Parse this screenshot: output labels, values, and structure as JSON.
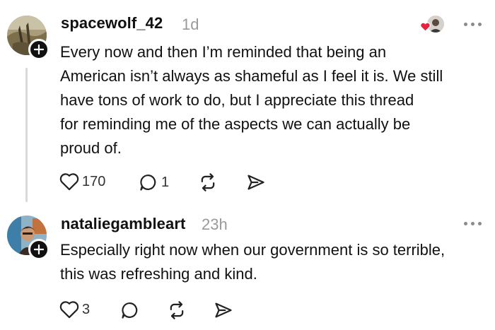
{
  "posts": [
    {
      "username": "spacewolf_42",
      "timestamp": "1d",
      "text_lines": [
        "Every now and then I’m reminded that being an",
        "American isn’t always as shameful as I feel it is. We still",
        "have tons of work to do, but I appreciate this thread",
        "for reminding me of the aspects we can actually be",
        "proud of."
      ],
      "like_count": "170",
      "reply_count": "1",
      "icons": [
        "heart-icon",
        "comment-icon",
        "repost-icon",
        "share-icon"
      ]
    },
    {
      "username": "nataliegambleart",
      "timestamp": "23h",
      "text_lines": [
        "Especially right now when our government is so terrible,",
        "this was refreshing and kind."
      ],
      "like_count": "3",
      "icons": [
        "heart-icon",
        "comment-icon",
        "repost-icon",
        "share-icon"
      ]
    }
  ],
  "colors": {
    "liked_heart": "#e8233d",
    "muted": "#9a9a9a",
    "text": "#111111"
  }
}
